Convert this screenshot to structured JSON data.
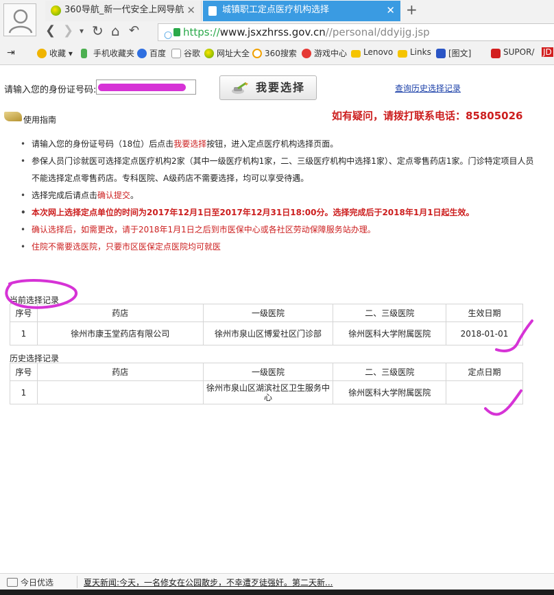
{
  "browser": {
    "tabs": [
      {
        "label": "360导航_新一代安全上网导航",
        "close": "✕"
      },
      {
        "label": "城镇职工定点医疗机构选择",
        "close": "✕"
      }
    ],
    "new_tab": "+",
    "nav": {
      "back": "❮",
      "forward": "❯",
      "dropdown": "▾",
      "refresh": "↻",
      "home": "⌂",
      "undo": "↶"
    },
    "url": {
      "scheme": "https://",
      "host": "www.jsxzhrss.gov.cn",
      "path": "//personal/ddyijg.jsp"
    },
    "bookmarks": [
      "收藏",
      "手机收藏夹",
      "百度",
      "谷歌",
      "网址大全",
      "360搜索",
      "游戏中心",
      "Lenovo",
      "Links",
      "[图文]",
      "SUPOR/",
      "JD"
    ]
  },
  "form": {
    "id_label": "请输入您的身份证号码:",
    "select_button": "我要选择",
    "history_link": "查询历史选择记录"
  },
  "guide": {
    "title": "使用指南",
    "hotline": "如有疑问，请拨打联系电话：85805026",
    "notes": [
      {
        "parts": [
          {
            "t": "请输入您的身份证号码（18位）后点击"
          },
          {
            "t": "我要选择",
            "red": true
          },
          {
            "t": "按钮，进入定点医疗机构选择页面。"
          }
        ]
      },
      {
        "parts": [
          {
            "t": "参保人员门诊就医可选择定点医疗机构2家（其中一级医疗机构1家，二、三级医疗机构中选择1家）、定点零售药店1家。门诊特定项目人员不能选择定点零售药店。专科医院、A级药店不需要选择，均可以享受待遇。"
          }
        ]
      },
      {
        "parts": [
          {
            "t": "选择完成后请点击"
          },
          {
            "t": "确认提交",
            "red": true
          },
          {
            "t": "。"
          }
        ]
      },
      {
        "parts": [
          {
            "t": "本次网上选择定点单位的时间为2017年12月1日至2017年12月31日18:00分。选择完成后于2018年1月1日起生效。",
            "red": true
          }
        ],
        "bold": true
      },
      {
        "parts": [
          {
            "t": "确认选择后，如需更改，请于2018年1月1日之后到市医保中心或各社区劳动保障服务站办理。",
            "red": true
          }
        ]
      },
      {
        "parts": [
          {
            "t": "住院不需要选医院，只要市区医保定点医院均可就医",
            "red": true
          }
        ]
      }
    ]
  },
  "current_records": {
    "title": "当前选择记录",
    "headers": [
      "序号",
      "药店",
      "一级医院",
      "二、三级医院",
      "生效日期"
    ],
    "rows": [
      [
        "1",
        "徐州市康玉堂药店有限公司",
        "徐州市泉山区博爱社区门诊部",
        "徐州医科大学附属医院",
        "2018-01-01"
      ]
    ]
  },
  "history_records": {
    "title": "历史选择记录",
    "headers": [
      "序号",
      "药店",
      "一级医院",
      "二、三级医院",
      "定点日期"
    ],
    "rows": [
      [
        "1",
        "",
        "徐州市泉山区湖滨社区卫生服务中心",
        "徐州医科大学附属医院",
        ""
      ]
    ]
  },
  "status": {
    "pick": "今日优选",
    "news": "夏天新闻:今天，一名修女在公园散步，不幸遭歹徒强奸。第二天新..."
  },
  "colors": {
    "accent": "#3a9be2",
    "red": "#cc1e1e",
    "link": "#1a3fa8",
    "annotation": "#d633d6"
  }
}
